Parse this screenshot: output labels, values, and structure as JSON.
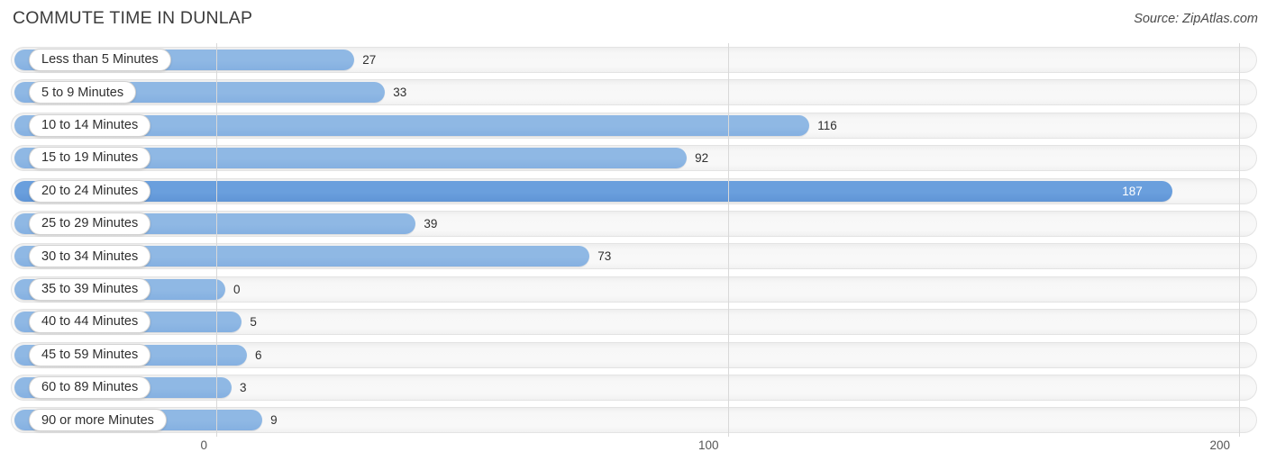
{
  "header": {
    "title": "COMMUTE TIME IN DUNLAP",
    "source": "Source: ZipAtlas.com"
  },
  "colors": {
    "bar_light": "#8fb8e4",
    "bar_dark": "#6a9fdd",
    "track": "#f7f7f7",
    "gridline": "#d9d9d9",
    "text": "#2f2f2f"
  },
  "chart_data": {
    "type": "bar",
    "orientation": "horizontal",
    "title": "COMMUTE TIME IN DUNLAP",
    "source": "Source: ZipAtlas.com",
    "xlabel": "",
    "ylabel": "",
    "xlim": [
      0,
      200
    ],
    "xticks": [
      0,
      100,
      200
    ],
    "xtick_labels": [
      "0",
      "100",
      "200"
    ],
    "grid": true,
    "legend": false,
    "categories": [
      "Less than 5 Minutes",
      "5 to 9 Minutes",
      "10 to 14 Minutes",
      "15 to 19 Minutes",
      "20 to 24 Minutes",
      "25 to 29 Minutes",
      "30 to 34 Minutes",
      "35 to 39 Minutes",
      "40 to 44 Minutes",
      "45 to 59 Minutes",
      "60 to 89 Minutes",
      "90 or more Minutes"
    ],
    "values": [
      27,
      33,
      116,
      92,
      187,
      39,
      73,
      0,
      5,
      6,
      3,
      9
    ],
    "value_labels": [
      "27",
      "33",
      "116",
      "92",
      "187",
      "39",
      "73",
      "0",
      "5",
      "6",
      "3",
      "9"
    ],
    "max_value": 187,
    "highlight_index": 4
  },
  "axis": {
    "ticks": [
      {
        "label": "0",
        "value": 0
      },
      {
        "label": "100",
        "value": 100
      },
      {
        "label": "200",
        "value": 200
      }
    ]
  }
}
